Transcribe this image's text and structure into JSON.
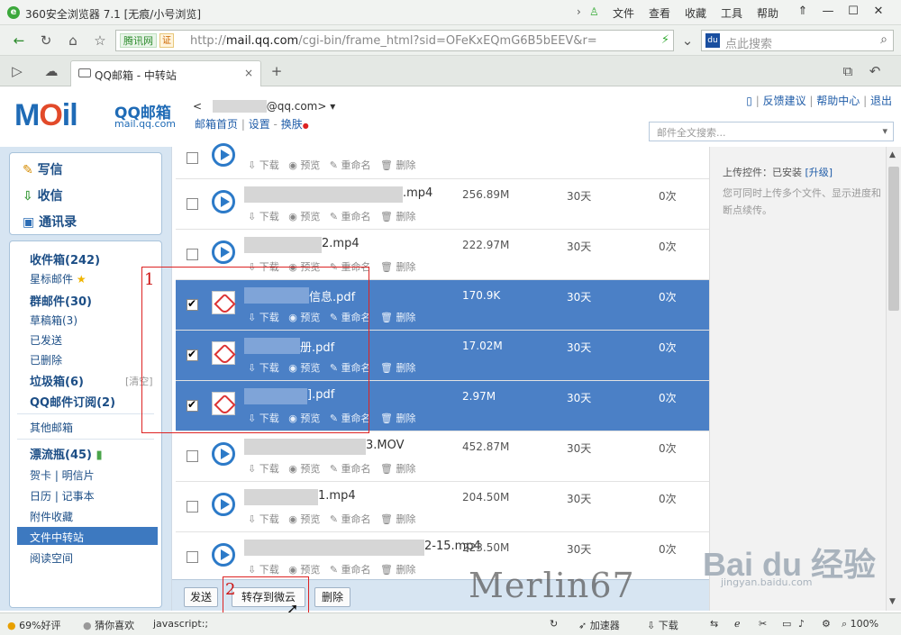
{
  "browser": {
    "title": "360安全浏览器 7.1 [无痕/小号浏览]",
    "menus": [
      "文件",
      "查看",
      "收藏",
      "工具",
      "帮助"
    ],
    "url_tag": "腾讯网",
    "url_cert": "证",
    "url_prefix": "http://",
    "url_host": "mail.qq.com",
    "url_rest": "/cgi-bin/frame_html?sid=OFeKxEQmG6B5bEEV&r=",
    "search_placeholder": "点此搜索",
    "tab_title": "QQ邮箱 - 中转站",
    "tab_add": "+"
  },
  "mail": {
    "logo_text": "MOil",
    "logo_name": "QQ邮箱",
    "logo_domain": "mail.qq.com",
    "user_addr_prefix": "<",
    "user_addr_suffix": "1@qq.com>",
    "home_link": "邮箱首页",
    "settings_link": "设置",
    "skin_link": "换肤",
    "feedback": "反馈建议",
    "help": "帮助中心",
    "logout": "退出",
    "fulltext_search": "邮件全文搜索..."
  },
  "nav": {
    "compose": "写信",
    "inbox_action": "收信",
    "contacts": "通讯录",
    "items": [
      {
        "label": "收件箱(242)",
        "bold": true
      },
      {
        "label": "星标邮件",
        "bold": false
      },
      {
        "label": "群邮件(30)",
        "bold": true
      },
      {
        "label": "草稿箱(3)",
        "bold": false
      },
      {
        "label": "已发送",
        "bold": false
      },
      {
        "label": "已删除",
        "bold": false
      },
      {
        "label": "垃圾箱(6)",
        "bold": true
      },
      {
        "label": "QQ邮件订阅(2)",
        "bold": true
      },
      {
        "label": "其他邮箱",
        "bold": false
      },
      {
        "label": "漂流瓶(45)",
        "bold": true
      },
      {
        "label": "贺卡 | 明信片",
        "bold": false
      },
      {
        "label": "日历 | 记事本",
        "bold": false
      },
      {
        "label": "附件收藏",
        "bold": false
      },
      {
        "label": "文件中转站",
        "bold": false,
        "selected": true
      },
      {
        "label": "阅读空间",
        "bold": false
      }
    ],
    "clear_label": "[清空]"
  },
  "files": {
    "actions": {
      "download": "下载",
      "preview": "预览",
      "rename": "重命名",
      "delete": "删除"
    },
    "rows": [
      {
        "name": ".mp4",
        "size": "256.89M",
        "days": "30天",
        "count": "0次",
        "type": "video",
        "checked": false
      },
      {
        "name": "2.mp4",
        "size": "222.97M",
        "days": "30天",
        "count": "0次",
        "type": "video",
        "checked": false
      },
      {
        "name": "信息.pdf",
        "size": "170.9K",
        "days": "30天",
        "count": "0次",
        "type": "pdf",
        "checked": true
      },
      {
        "name": "册.pdf",
        "size": "17.02M",
        "days": "30天",
        "count": "0次",
        "type": "pdf",
        "checked": true
      },
      {
        "name": "].pdf",
        "size": "2.97M",
        "days": "30天",
        "count": "0次",
        "type": "pdf",
        "checked": true
      },
      {
        "name": "3.MOV",
        "size": "452.87M",
        "days": "30天",
        "count": "0次",
        "type": "video",
        "checked": false
      },
      {
        "name": "1.mp4",
        "size": "204.50M",
        "days": "30天",
        "count": "0次",
        "type": "video",
        "checked": false
      },
      {
        "name": "2-15.mp4",
        "size": "223.50M",
        "days": "30天",
        "count": "0次",
        "type": "video",
        "checked": false
      }
    ],
    "buttons": {
      "send": "发送",
      "to_cloud": "转存到微云",
      "delete": "删除"
    }
  },
  "right_panel": {
    "upload_label": "上传控件：已安装",
    "upgrade": "[升级]",
    "tip": "您可同时上传多个文件、显示进度和断点续传。"
  },
  "annotations": {
    "one": "1",
    "two": "2",
    "watermark": "Merlin67",
    "baidu": "Bai du 经验",
    "baidu_url": "jingyan.baidu.com"
  },
  "status": {
    "rating": "69%好评",
    "guess": "猜你喜欢",
    "js": "javascript:;",
    "accel": "加速器",
    "download": "下载",
    "zoom": "100%"
  }
}
